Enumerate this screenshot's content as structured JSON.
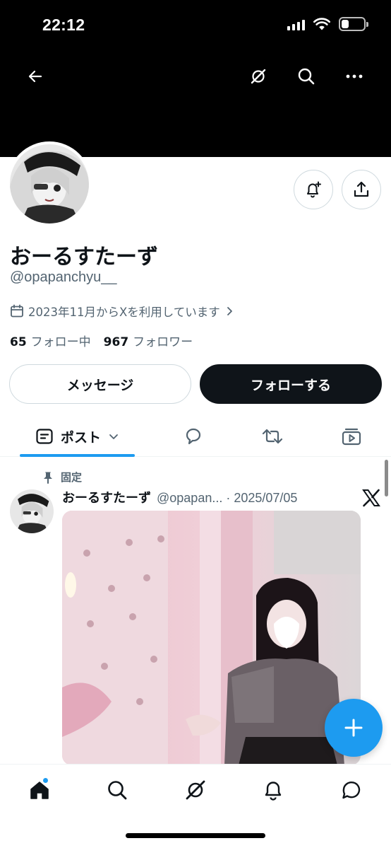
{
  "status_bar": {
    "time": "22:12"
  },
  "profile": {
    "display_name": "おーるすたーず",
    "handle": "@opapanchyu__",
    "joined": "2023年11月からXを利用しています",
    "following_count": "65",
    "following_label": "フォロー中",
    "followers_count": "967",
    "followers_label": "フォロワー"
  },
  "actions": {
    "message_label": "メッセージ",
    "follow_label": "フォローする"
  },
  "tabs": {
    "posts_label": "ポスト"
  },
  "post": {
    "pinned_label": "固定",
    "author_name": "おーるすたーず",
    "author_handle_date": "@opapan... · 2025/07/05"
  },
  "colors": {
    "accent": "#1d9bf0",
    "text_primary": "#0f1419",
    "text_secondary": "#536471",
    "border": "#cfd9de"
  },
  "icons": {
    "back": "arrow-left-icon",
    "grok": "grok-icon",
    "search": "search-icon",
    "more": "more-icon",
    "notify": "bell-plus-icon",
    "share": "share-icon",
    "calendar": "calendar-icon",
    "pin": "pin-icon",
    "x_logo": "x-logo-icon",
    "compose": "plus-icon",
    "home": "home-icon",
    "notifications": "bell-icon",
    "messages": "message-icon"
  }
}
